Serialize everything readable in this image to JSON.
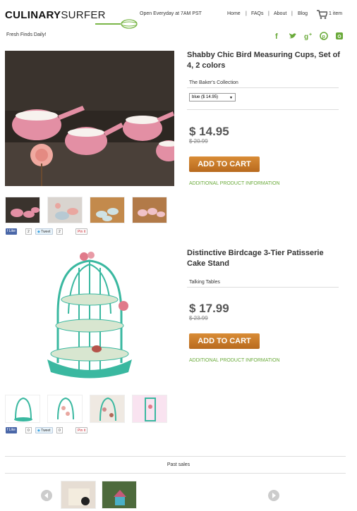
{
  "header": {
    "logo_bold": "CULINARY",
    "logo_light": "SURFER",
    "hours": "Open Everyday at 7AM PST",
    "nav": [
      "Home",
      "FAQs",
      "About",
      "Blog"
    ],
    "separator": "|",
    "cart_count": "1 item",
    "tagline": "Fresh Finds Daily!",
    "social_icons": [
      "facebook-icon",
      "twitter-icon",
      "google-plus-icon",
      "pinterest-icon",
      "instagram-icon"
    ],
    "accent_color": "#6aaa3a"
  },
  "products": [
    {
      "title": "Shabby Chic Bird Measuring Cups, Set of 4, 2 colors",
      "brand": "The Baker's Collection",
      "option_selected": "blue ($ 14.95)",
      "price": "$ 14.95",
      "old_price": "$ 20.99",
      "cart_label": "ADD TO CART",
      "info_label": "ADDITIONAL PRODUCT INFORMATION",
      "like_label": "Like",
      "like_count": "2",
      "tweet_label": "Tweet",
      "tweet_count": "2",
      "pin_label": "Pin it"
    },
    {
      "title": "Distinctive Birdcage 3-Tier Patisserie Cake Stand",
      "brand": "Talking Tables",
      "price": "$ 17.99",
      "old_price": "$ 23.99",
      "cart_label": "ADD TO CART",
      "info_label": "ADDITIONAL PRODUCT INFORMATION",
      "like_label": "Like",
      "like_count": "0",
      "tweet_label": "Tweet",
      "tweet_count": "0",
      "pin_label": "Pin it"
    }
  ],
  "past_sales": {
    "label": "Past sales"
  },
  "colors": {
    "cart_button": "#c87a2a",
    "link_green": "#6aaa3a"
  }
}
